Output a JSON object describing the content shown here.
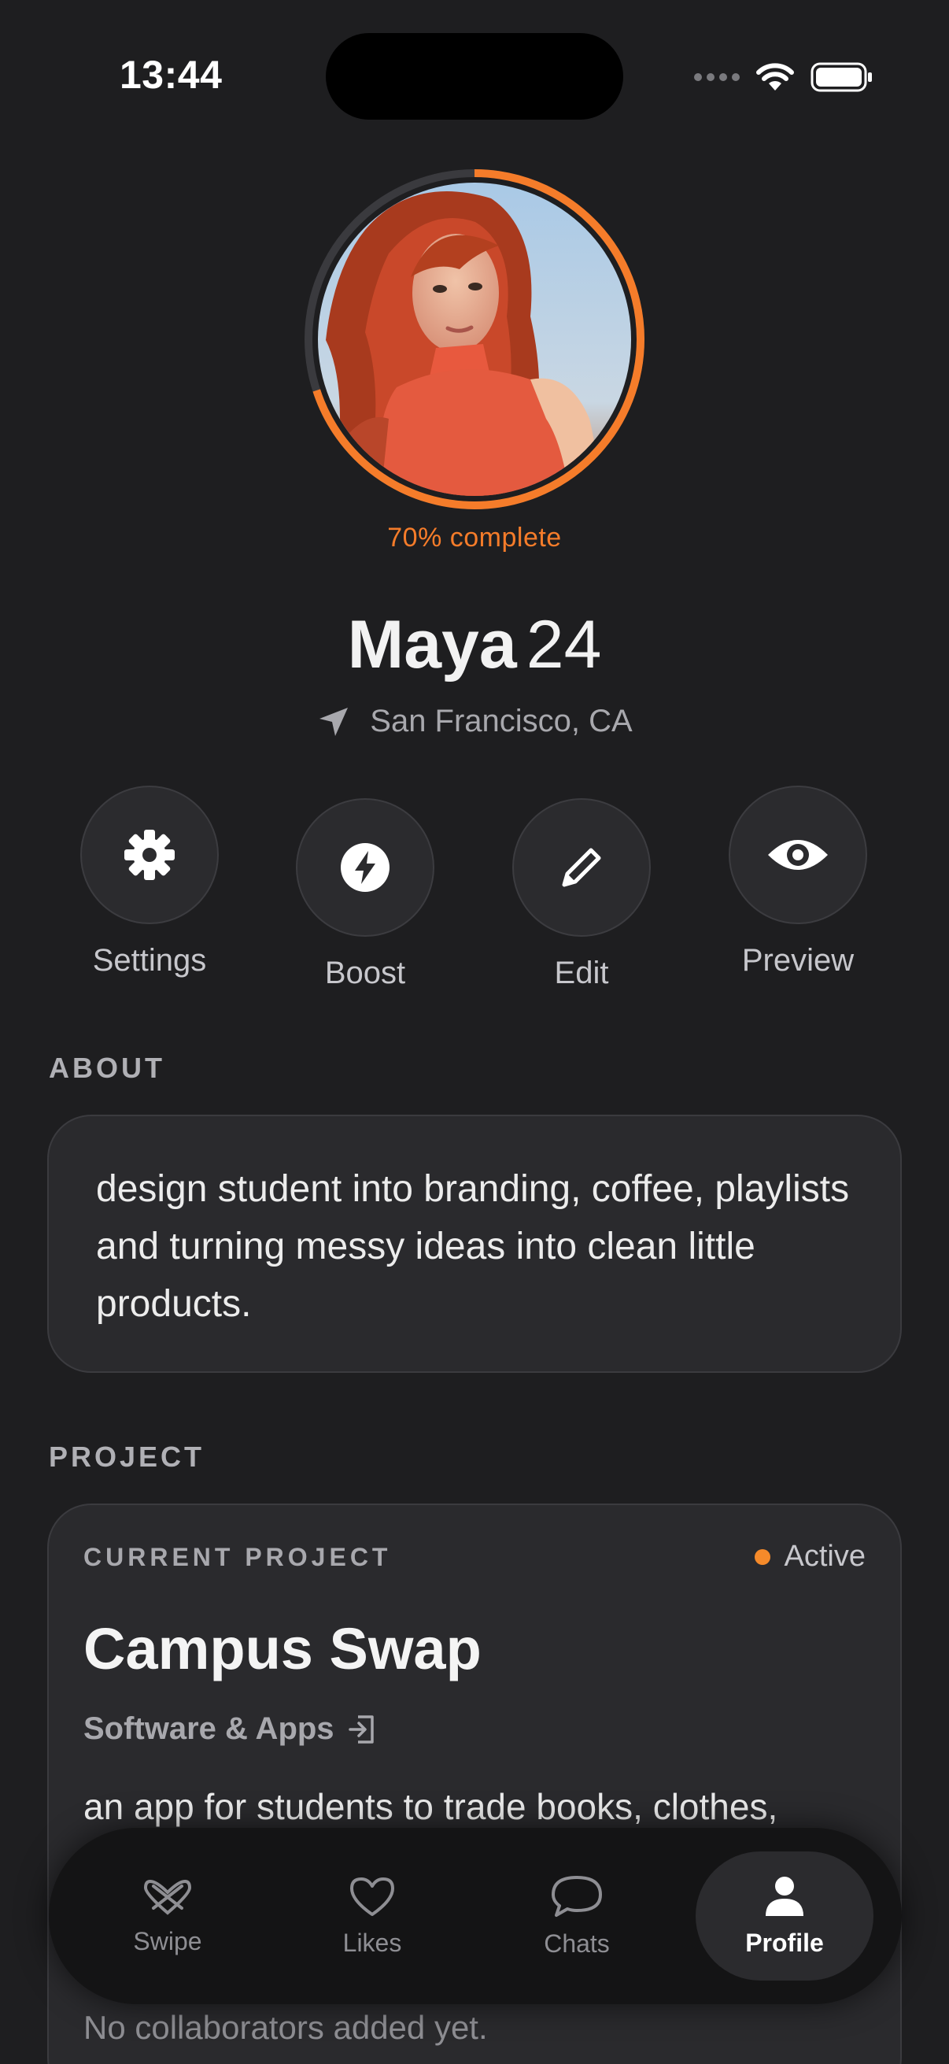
{
  "status_bar": {
    "time": "13:44"
  },
  "profile": {
    "completion_label": "70% complete",
    "completion_fraction": 0.7,
    "name": "Maya",
    "age": "24",
    "location": "San Francisco, CA"
  },
  "actions": [
    {
      "label": "Settings",
      "icon": "gear-icon"
    },
    {
      "label": "Boost",
      "icon": "bolt-icon"
    },
    {
      "label": "Edit",
      "icon": "pencil-icon"
    },
    {
      "label": "Preview",
      "icon": "eye-icon"
    }
  ],
  "about": {
    "title": "ABOUT",
    "text": "design student into branding, coffee, playlists and turning messy ideas into clean little products."
  },
  "project": {
    "section_title": "PROJECT",
    "eyebrow": "CURRENT PROJECT",
    "status": "Active",
    "title": "Campus Swap",
    "category": "Software & Apps",
    "description": "an app for students to trade books, clothes,",
    "collaborators": "No collaborators added yet."
  },
  "tabs": [
    {
      "label": "Swipe",
      "icon": "swipe-icon",
      "active": false
    },
    {
      "label": "Likes",
      "icon": "heart-icon",
      "active": false
    },
    {
      "label": "Chats",
      "icon": "chat-bubble-icon",
      "active": false
    },
    {
      "label": "Profile",
      "icon": "person-icon",
      "active": true
    }
  ],
  "colors": {
    "accent": "#f57c2a",
    "background": "#1e1e20",
    "card": "#2a2a2d"
  }
}
